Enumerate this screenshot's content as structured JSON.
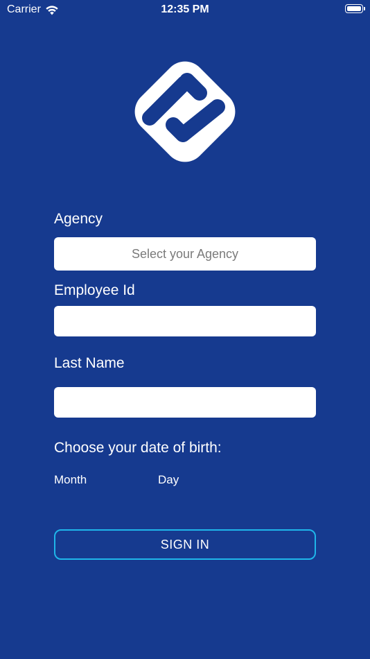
{
  "status_bar": {
    "carrier": "Carrier",
    "time": "12:35 PM"
  },
  "form": {
    "agency_label": "Agency",
    "agency_placeholder": "Select your Agency",
    "employee_id_label": "Employee Id",
    "employee_id_value": "",
    "last_name_label": "Last Name",
    "last_name_value": "",
    "dob_prompt": "Choose your date of birth:",
    "dob_month_label": "Month",
    "dob_day_label": "Day",
    "sign_in_label": "SIGN IN"
  },
  "colors": {
    "background": "#163A8F",
    "accent": "#1FB6EA",
    "field_background": "#FFFFFF"
  },
  "icons": {
    "logo": "app-logo-icon",
    "wifi": "wifi-icon",
    "battery": "battery-icon"
  }
}
